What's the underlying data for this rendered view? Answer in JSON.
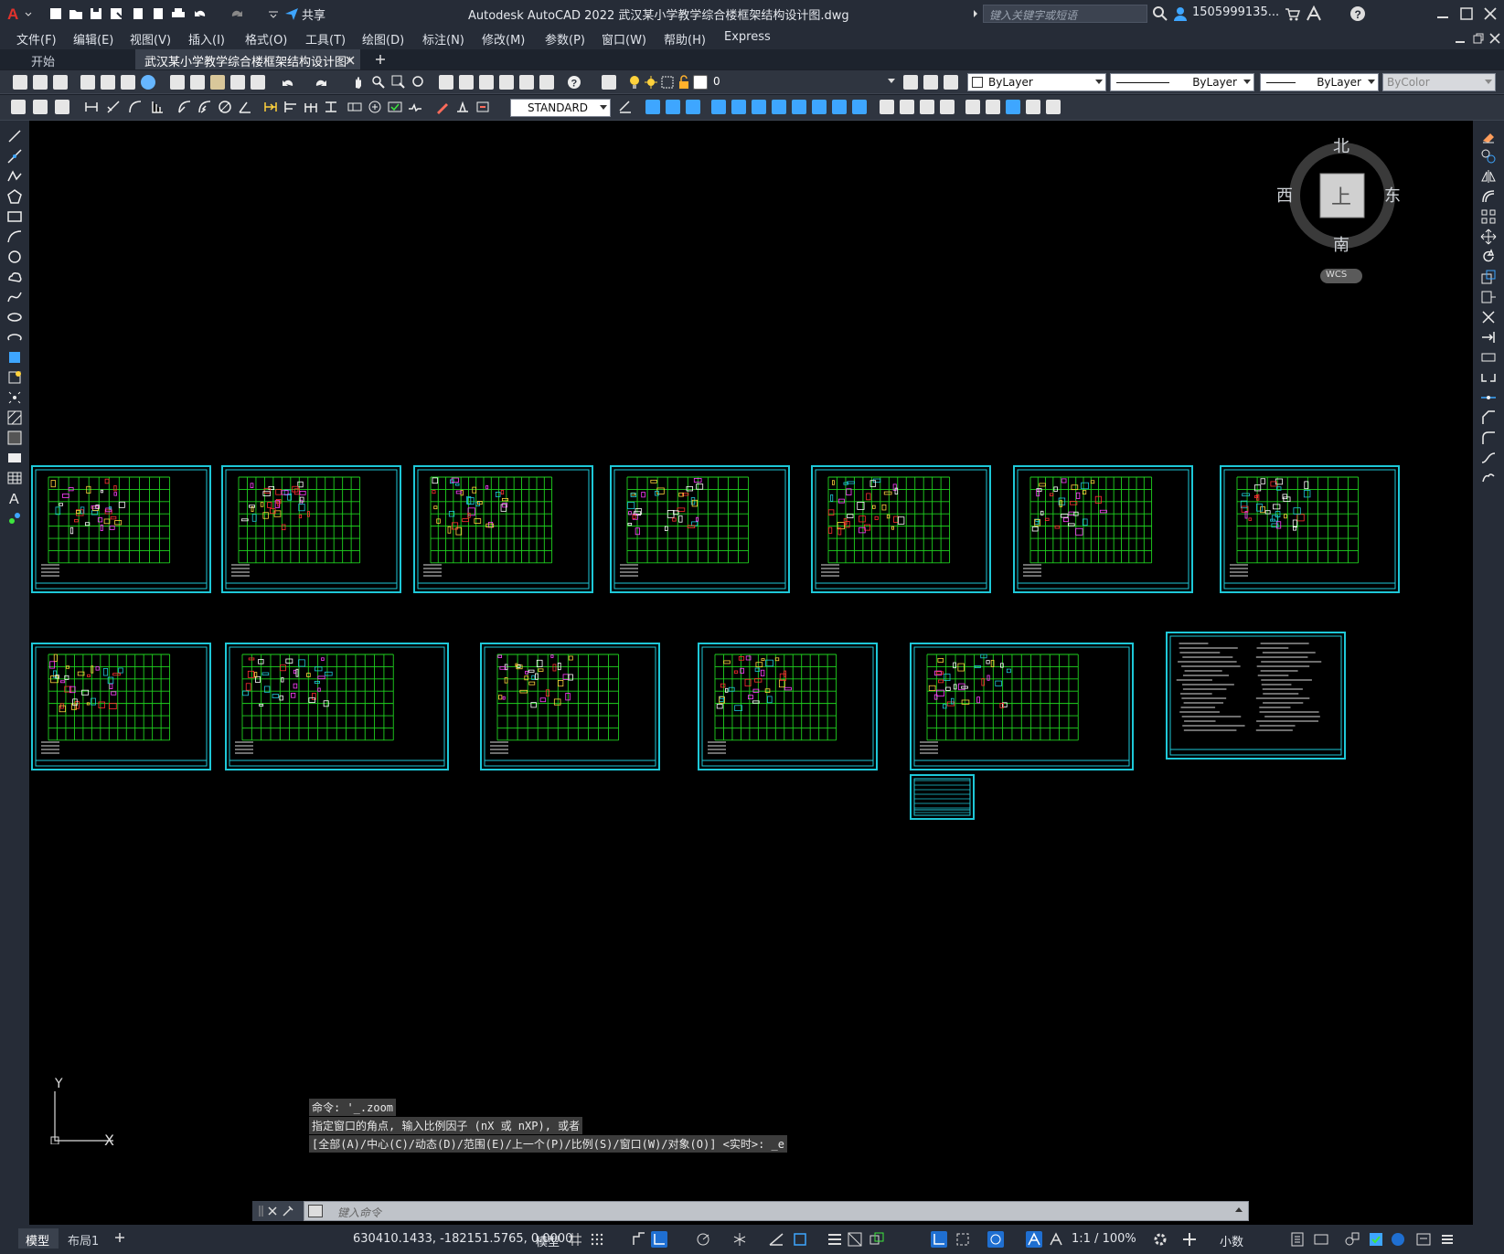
{
  "window": {
    "title": "Autodesk AutoCAD 2022    武汉某小学教学综合楼框架结构设计图.dwg",
    "search_placeholder": "键入关键字或短语",
    "user": "1505999135...",
    "share_label": "共享"
  },
  "menu": [
    "文件(F)",
    "编辑(E)",
    "视图(V)",
    "插入(I)",
    "格式(O)",
    "工具(T)",
    "绘图(D)",
    "标注(N)",
    "修改(M)",
    "参数(P)",
    "窗口(W)",
    "帮助(H)",
    "Express"
  ],
  "tabs": [
    {
      "label": "开始",
      "active": false
    },
    {
      "label": "武汉某小学教学综合楼框架结构设计图*",
      "active": true
    }
  ],
  "toolbar1": {
    "layer_value": "0",
    "color_value": "ByLayer",
    "linetype_value": "ByLayer",
    "lineweight_value": "ByLayer",
    "plotstyle_value": "ByColor"
  },
  "toolbar2": {
    "textstyle_value": "STANDARD"
  },
  "viewcube": {
    "north": "北",
    "south": "南",
    "east": "东",
    "west": "西",
    "face": "上",
    "wcs": "WCS"
  },
  "ucs": {
    "x": "X",
    "y": "Y"
  },
  "command_history": [
    "命令: '_.zoom",
    "指定窗口的角点, 输入比例因子 (nX 或 nXP), 或者",
    "[全部(A)/中心(C)/动态(D)/范围(E)/上一个(P)/比例(S)/窗口(W)/对象(O)] <实时>: _e"
  ],
  "command_placeholder": "键入命令",
  "layout_tabs": [
    {
      "label": "模型",
      "active": true
    },
    {
      "label": "布局1",
      "active": false
    }
  ],
  "status": {
    "coords": "630410.1433, -182151.5765, 0.0000",
    "space": "模型",
    "scale": "1:1 / 100%",
    "units": "小数"
  },
  "colors": {
    "canvas": "#000000",
    "sheet_border": "#1ec8d8",
    "grid": "#1fd21f",
    "accent": "#0a84ff"
  }
}
